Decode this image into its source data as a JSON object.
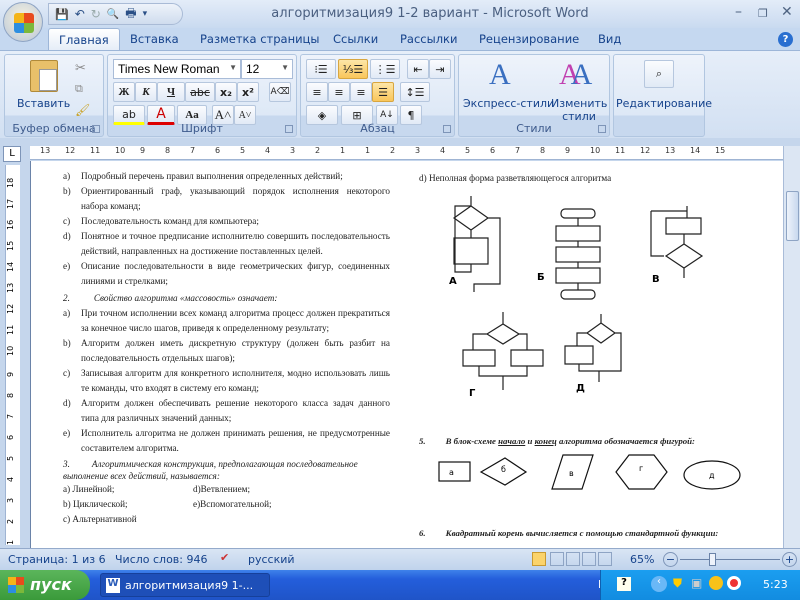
{
  "window": {
    "title": "алгоритмизация9 1-2 вариант - Microsoft Word",
    "minimize": "–",
    "restore": "❐",
    "close": "✕"
  },
  "qat": {
    "save": "💾",
    "undo": "↶",
    "redo": "↻",
    "preview": "🔍",
    "print": "🖶",
    "customize": "▾"
  },
  "tabs": [
    "Главная",
    "Вставка",
    "Разметка страницы",
    "Ссылки",
    "Рассылки",
    "Рецензирование",
    "Вид"
  ],
  "active_tab": "Главная",
  "help": "?",
  "ribbon": {
    "clipboard": {
      "label": "Буфер обмена",
      "paste": "Вставить"
    },
    "font": {
      "label": "Шрифт",
      "font_name": "Times New Roman",
      "font_size": "12",
      "bold": "Ж",
      "italic": "К",
      "underline": "Ч",
      "strike": "abc",
      "sub": "x₂",
      "sup": "x²",
      "grow": "A˄",
      "shrink": "A˅",
      "case": "Aa",
      "highlight": "ab",
      "color": "A"
    },
    "paragraph": {
      "label": "Абзац",
      "pilcrow": "¶"
    },
    "styles": {
      "label": "Стили",
      "quick": "Экспресс-стили",
      "change": "Изменить стили"
    },
    "editing": {
      "label": "Редактирование"
    }
  },
  "ruler_tab": "L",
  "document": {
    "left": {
      "q1_items": [
        {
          "m": "a)",
          "t": "Подробный перечень правил выполнения определенных действий;"
        },
        {
          "m": "b)",
          "t": "Ориентированный граф, указывающий порядок исполнения некоторого набора команд;"
        },
        {
          "m": "c)",
          "t": "Последовательность команд для компьютера;"
        },
        {
          "m": "d)",
          "t": "Понятное и точное предписание исполнителю совершить последовательность действий, направленных на достижение поставленных целей."
        },
        {
          "m": "e)",
          "t": "Описание последовательности в виде геометрических фигур, соединенных линиями и стрелками;"
        }
      ],
      "q2": {
        "num": "2.",
        "text": "Свойство алгоритма «массовость» означает:"
      },
      "q2_items": [
        {
          "m": "a)",
          "t": "При точном исполнении всех команд алгоритма процесс должен прекратиться за конечное число шагов, приведя к определенному результату;"
        },
        {
          "m": "b)",
          "t": "Алгоритм должен иметь дискретную структуру (должен быть разбит на последовательность отдельных шагов);"
        },
        {
          "m": "c)",
          "t": "Записывая алгоритм для конкретного исполнителя, модно использовать лишь те команды, что входят в систему его команд;"
        },
        {
          "m": "d)",
          "t": "Алгоритм должен обеспечивать решение некоторого класса задач данного типа для различных значений данных;"
        },
        {
          "m": "e)",
          "t": "Исполнитель алгоритма не должен принимать решения, не предусмотренные составителем алгоритма."
        }
      ],
      "q3": {
        "num": "3.",
        "text": "Алгоритмическая конструкция, предполагающая последовательное выполнение всех действий, называется:"
      },
      "q3_items": [
        {
          "a": "a) Линейной;",
          "b": "d)Ветвлением;"
        },
        {
          "a": "b) Циклической;",
          "b": "e)Вспомогательной;"
        },
        {
          "a": "c) Альтернативной",
          "b": ""
        }
      ]
    },
    "right": {
      "q4_item": "d)  Неполная форма разветвляющегося алгоритма",
      "diagram_labels": [
        "А",
        "Б",
        "В",
        "Г",
        "Д"
      ],
      "q5": {
        "num": "5.",
        "pre": "В блок-схеме ",
        "w1": "начало",
        "mid": " и ",
        "w2": "конец",
        "post": " алгоритма обозначается фигурой:"
      },
      "shape_labels": [
        "а",
        "б",
        "в",
        "г",
        "д"
      ],
      "q6": {
        "num": "6.",
        "text": "Квадратный корень вычисляется с помощью стандартной функции:"
      }
    }
  },
  "status": {
    "page": "Страница: 1 из 6",
    "words": "Число слов: 946",
    "language": "русский",
    "zoom": "65%",
    "zoom_percent": 65
  },
  "taskbar": {
    "start": "пуск",
    "task": "алгоритмизация9 1-...",
    "lang": "RU",
    "time": "5:23"
  }
}
